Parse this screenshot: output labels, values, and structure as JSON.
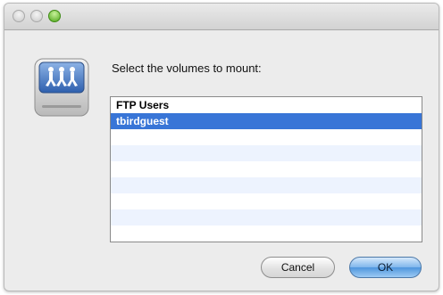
{
  "window": {
    "controls": [
      "close",
      "minimize",
      "zoom"
    ]
  },
  "dialog": {
    "icon": "shared-volume-icon",
    "prompt": "Select the volumes to mount:",
    "volumes": [
      {
        "label": "FTP Users",
        "selected": false
      },
      {
        "label": "tbirdguest",
        "selected": true
      }
    ],
    "empty_rows": 7,
    "buttons": {
      "cancel_label": "Cancel",
      "ok_label": "OK"
    }
  },
  "colors": {
    "selection": "#3875d7",
    "alt_row": "#edf3fe",
    "zoom_green": "#4ea61a"
  }
}
